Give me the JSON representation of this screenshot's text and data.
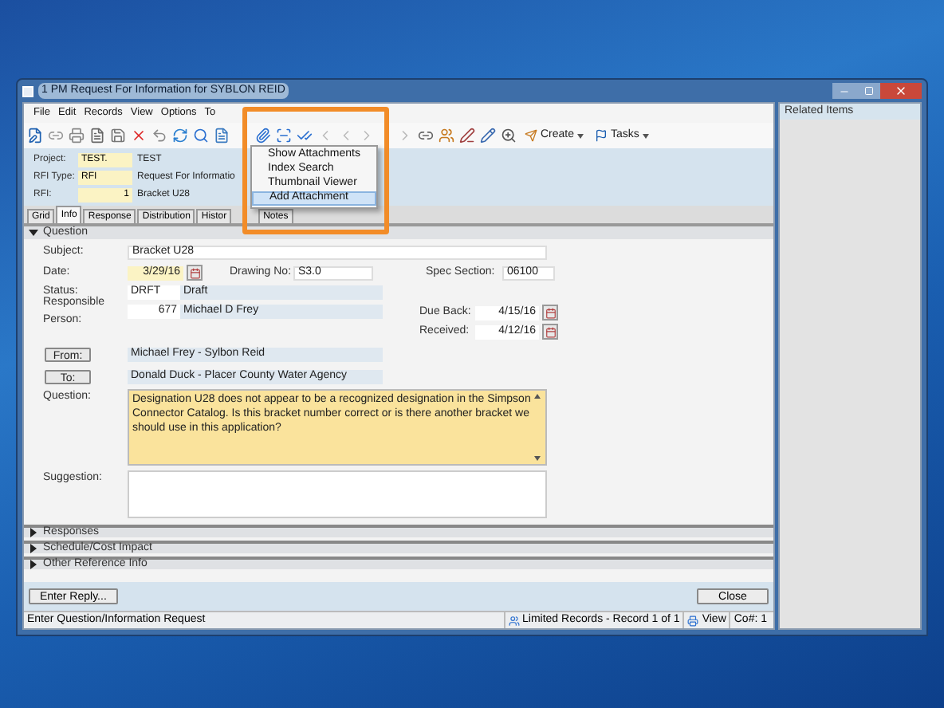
{
  "window": {
    "title": "1 PM Request For Information for SYBLON REID"
  },
  "menu": [
    "File",
    "Edit",
    "Records",
    "View",
    "Options",
    "To"
  ],
  "toolbar": {
    "buttons": [
      {
        "label": "Create"
      },
      {
        "label": "Tasks"
      }
    ]
  },
  "attachment_menu": {
    "items": [
      {
        "label": "Show Attachments",
        "selected": false
      },
      {
        "label": "Index Search",
        "selected": false
      },
      {
        "label": "Thumbnail Viewer",
        "selected": false
      },
      {
        "label": "Add Attachment",
        "selected": true
      }
    ]
  },
  "header": {
    "fields": [
      {
        "label": "Project:",
        "code": "TEST.",
        "description": "TEST"
      },
      {
        "label": "RFI Type:",
        "code": "RFI",
        "description": "Request For Informatio"
      },
      {
        "label": "RFI:",
        "code": "1",
        "description": "Bracket U28"
      }
    ]
  },
  "tabs": [
    {
      "label": "Grid",
      "selected": false
    },
    {
      "label": "Info",
      "selected": true
    },
    {
      "label": "Response",
      "selected": false
    },
    {
      "label": "Distribution",
      "selected": false
    },
    {
      "label": "Histor",
      "selected": false
    },
    {
      "label": "Notes",
      "selected": false
    }
  ],
  "question_section": {
    "title": "Question",
    "expanded": true,
    "subject": {
      "label": "Subject:",
      "value": "Bracket U28"
    },
    "date": {
      "label": "Date:",
      "value": "3/29/16"
    },
    "drawing_no": {
      "label": "Drawing No:",
      "value": "S3.0"
    },
    "spec_section": {
      "label": "Spec Section:",
      "value": "06100"
    },
    "status": {
      "label": "Status:",
      "code": "DRFT",
      "description": "Draft"
    },
    "responsible_person": {
      "label": "Responsible Person:",
      "code": "677",
      "description": "Michael D Frey"
    },
    "due_back": {
      "label": "Due Back:",
      "value": "4/15/16"
    },
    "received": {
      "label": "Received:",
      "value": "4/12/16"
    },
    "from": {
      "button": "From:",
      "value": "Michael Frey - Sylbon Reid"
    },
    "to": {
      "button": "To:",
      "value": "Donald Duck - Placer County Water Agency"
    },
    "question": {
      "label": "Question:",
      "value": "Designation U28 does not appear to be a recognized designation in the Simpson Connector Catalog.  Is this bracket number correct or is there another bracket we should use in this application?"
    },
    "suggestion": {
      "label": "Suggestion:"
    }
  },
  "sections": [
    {
      "title": "Responses",
      "expanded": false
    },
    {
      "title": "Schedule/Cost Impact",
      "expanded": false
    },
    {
      "title": "Other Reference Info",
      "expanded": false
    }
  ],
  "footer": {
    "reply_button": "Enter Reply...",
    "close_button": "Close"
  },
  "status_bar": {
    "message": "Enter Question/Information Request",
    "records": "Limited Records - Record 1 of 1",
    "mode": "View",
    "company": "Co#: 1"
  },
  "related_panel": {
    "title": "Related Items"
  }
}
